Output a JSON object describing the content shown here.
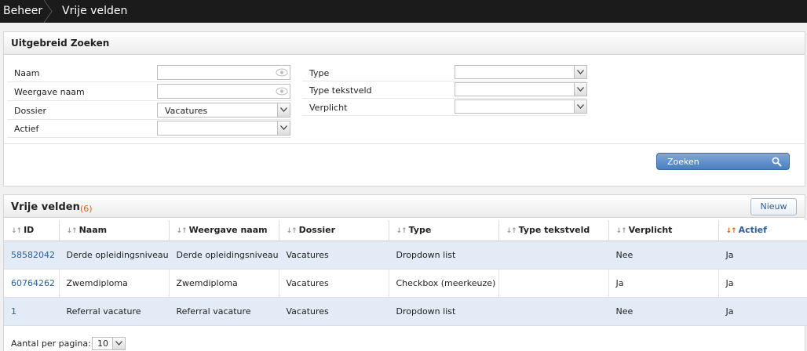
{
  "breadcrumb": {
    "root": "Beheer",
    "current": "Vrije velden"
  },
  "search": {
    "title": "Uitgebreid Zoeken",
    "fields": {
      "naam": {
        "label": "Naam",
        "value": ""
      },
      "weergave_naam": {
        "label": "Weergave naam",
        "value": ""
      },
      "dossier": {
        "label": "Dossier",
        "value": "Vacatures"
      },
      "actief": {
        "label": "Actief",
        "value": ""
      },
      "type": {
        "label": "Type",
        "value": ""
      },
      "type_tekstveld": {
        "label": "Type tekstveld",
        "value": ""
      },
      "verplicht": {
        "label": "Verplicht",
        "value": ""
      }
    },
    "button_label": "Zoeken"
  },
  "results": {
    "title": "Vrije velden",
    "count": "(6)",
    "new_button": "Nieuw",
    "columns": [
      "ID",
      "Naam",
      "Weergave naam",
      "Dossier",
      "Type",
      "Type tekstveld",
      "Verplicht",
      "Actief"
    ],
    "sorted_column": "Actief",
    "rows": [
      [
        "58582042",
        "Derde opleidingsniveau",
        "Derde opleidingsniveau",
        "Vacatures",
        "Dropdown list",
        "",
        "Nee",
        "Ja"
      ],
      [
        "60764262",
        "Zwemdiploma",
        "Zwemdiploma",
        "Vacatures",
        "Checkbox (meerkeuze)",
        "",
        "Ja",
        "Ja"
      ],
      [
        "1",
        "Referral vacature",
        "Referral vacature",
        "Vacatures",
        "Dropdown list",
        "",
        "Nee",
        "Ja"
      ]
    ]
  },
  "pager": {
    "label": "Aantal per pagina:",
    "value": "10"
  },
  "colors": {
    "accent": "#2b5f95",
    "topbar": "#1b1b1b",
    "count": "#e06010",
    "row_alt": "#e3ebf6"
  },
  "icons": [
    "eye-icon",
    "chevron-down-icon",
    "search-icon",
    "sort-icon"
  ]
}
